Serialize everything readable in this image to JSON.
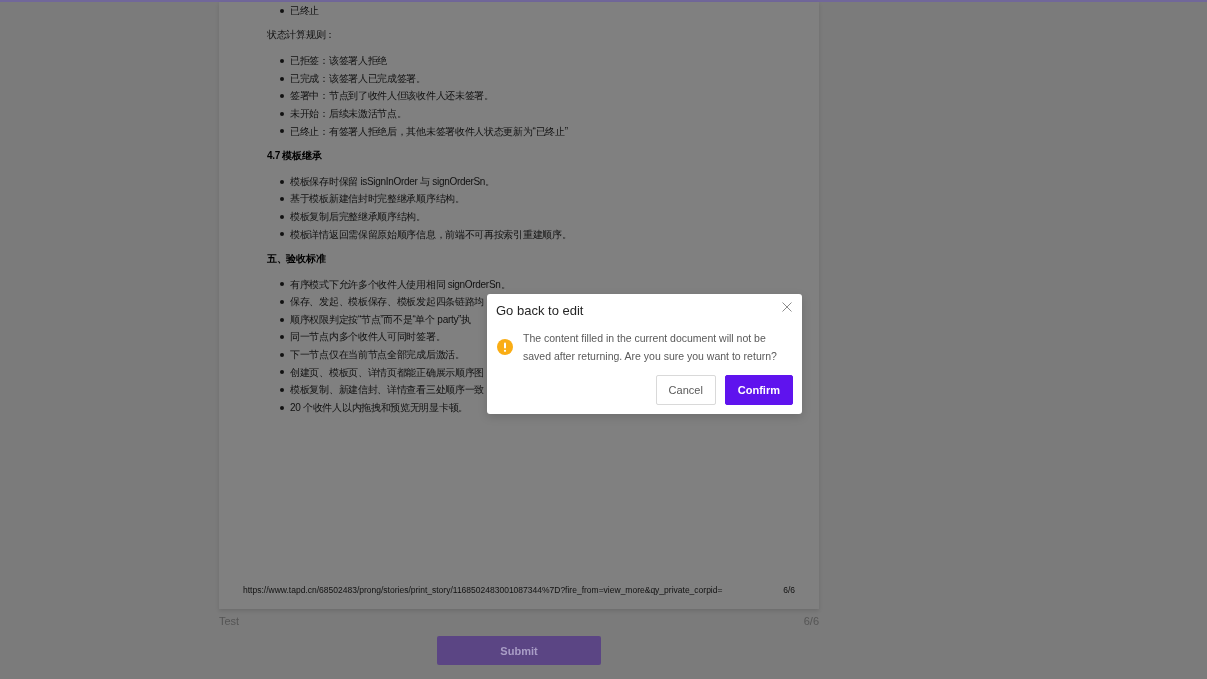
{
  "document": {
    "blocks": [
      {
        "kind": "list",
        "items": [
          "已终止"
        ]
      },
      {
        "kind": "paragraph",
        "text": "状态计算规则："
      },
      {
        "kind": "list",
        "items": [
          "已拒签：该签署人拒绝",
          "已完成：该签署人已完成签署。",
          "签署中：节点到了收件人但该收件人还未签署。",
          "未开始：后续未激活节点。",
          "已终止：有签署人拒绝后，其他未签署收件人状态更新为“已终止”"
        ]
      },
      {
        "kind": "heading",
        "text": "4.7 模板继承"
      },
      {
        "kind": "list",
        "items": [
          "模板保存时保留 isSignInOrder 与 signOrderSn。",
          "基于模板新建信封时完整继承顺序结构。",
          "模板复制后完整继承顺序结构。",
          "模板详情返回需保留原始顺序信息，前端不可再按索引重建顺序。"
        ]
      },
      {
        "kind": "heading",
        "text": "五、验收标准"
      },
      {
        "kind": "list",
        "items": [
          "有序模式下允许多个收件人使用相同 signOrderSn。",
          "保存、发起、模板保存、模板发起四条链路均",
          "顺序权限判定按“节点”而不是“单个 party”执",
          "同一节点内多个收件人可同时签署。",
          "下一节点仅在当前节点全部完成后激活。",
          "创建页、模板页、详情页都能正确展示顺序图",
          "模板复制、新建信封、详情查看三处顺序一致",
          "20 个收件人以内拖拽和预览无明显卡顿。"
        ]
      }
    ],
    "page_footer": {
      "url": "https://www.tapd.cn/68502483/prong/stories/print_story/1168502483001087344%7D?fire_from=view_more&qy_private_corpid=",
      "page_number": "6/6"
    }
  },
  "caption": {
    "name": "Test",
    "page_count": "6/6"
  },
  "submit_button": {
    "label": "Submit"
  },
  "dialog": {
    "title": "Go back to edit",
    "message": "The content filled in the current document will not be saved after returning. Are you sure you want to return?",
    "buttons": [
      {
        "label": "Cancel",
        "kind": "secondary"
      },
      {
        "label": "Confirm",
        "kind": "primary"
      }
    ]
  }
}
